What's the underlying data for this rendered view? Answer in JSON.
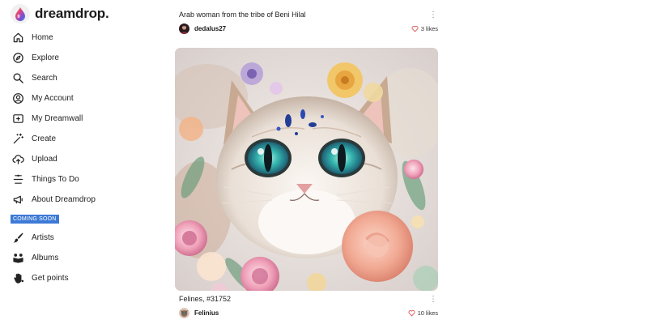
{
  "brand": {
    "name": "dreamdrop."
  },
  "nav": [
    {
      "label": "Home",
      "icon": "home-icon"
    },
    {
      "label": "Explore",
      "icon": "compass-icon"
    },
    {
      "label": "Search",
      "icon": "search-icon"
    },
    {
      "label": "My Account",
      "icon": "account-icon"
    },
    {
      "label": "My Dreamwall",
      "icon": "dreamwall-icon"
    },
    {
      "label": "Create",
      "icon": "magic-wand-icon"
    },
    {
      "label": "Upload",
      "icon": "cloud-upload-icon"
    },
    {
      "label": "Things To Do",
      "icon": "checklist-icon"
    },
    {
      "label": "About Dreamdrop",
      "icon": "megaphone-icon"
    }
  ],
  "coming_soon": {
    "label": "COMING SOON"
  },
  "nav2": [
    {
      "label": "Artists",
      "icon": "brush-icon"
    },
    {
      "label": "Albums",
      "icon": "albums-icon"
    },
    {
      "label": "Get points",
      "icon": "hand-points-icon"
    }
  ],
  "posts": [
    {
      "title": "Arab woman from the tribe of Beni Hilal",
      "username": "dedalus27",
      "likes": "3 likes"
    },
    {
      "title": "Felines, #31752",
      "username": "Felinius",
      "likes": "10 likes"
    }
  ],
  "colors": {
    "accent": "#3d7ad6",
    "heart": "#e05a5a",
    "text": "#1a1a1a"
  }
}
